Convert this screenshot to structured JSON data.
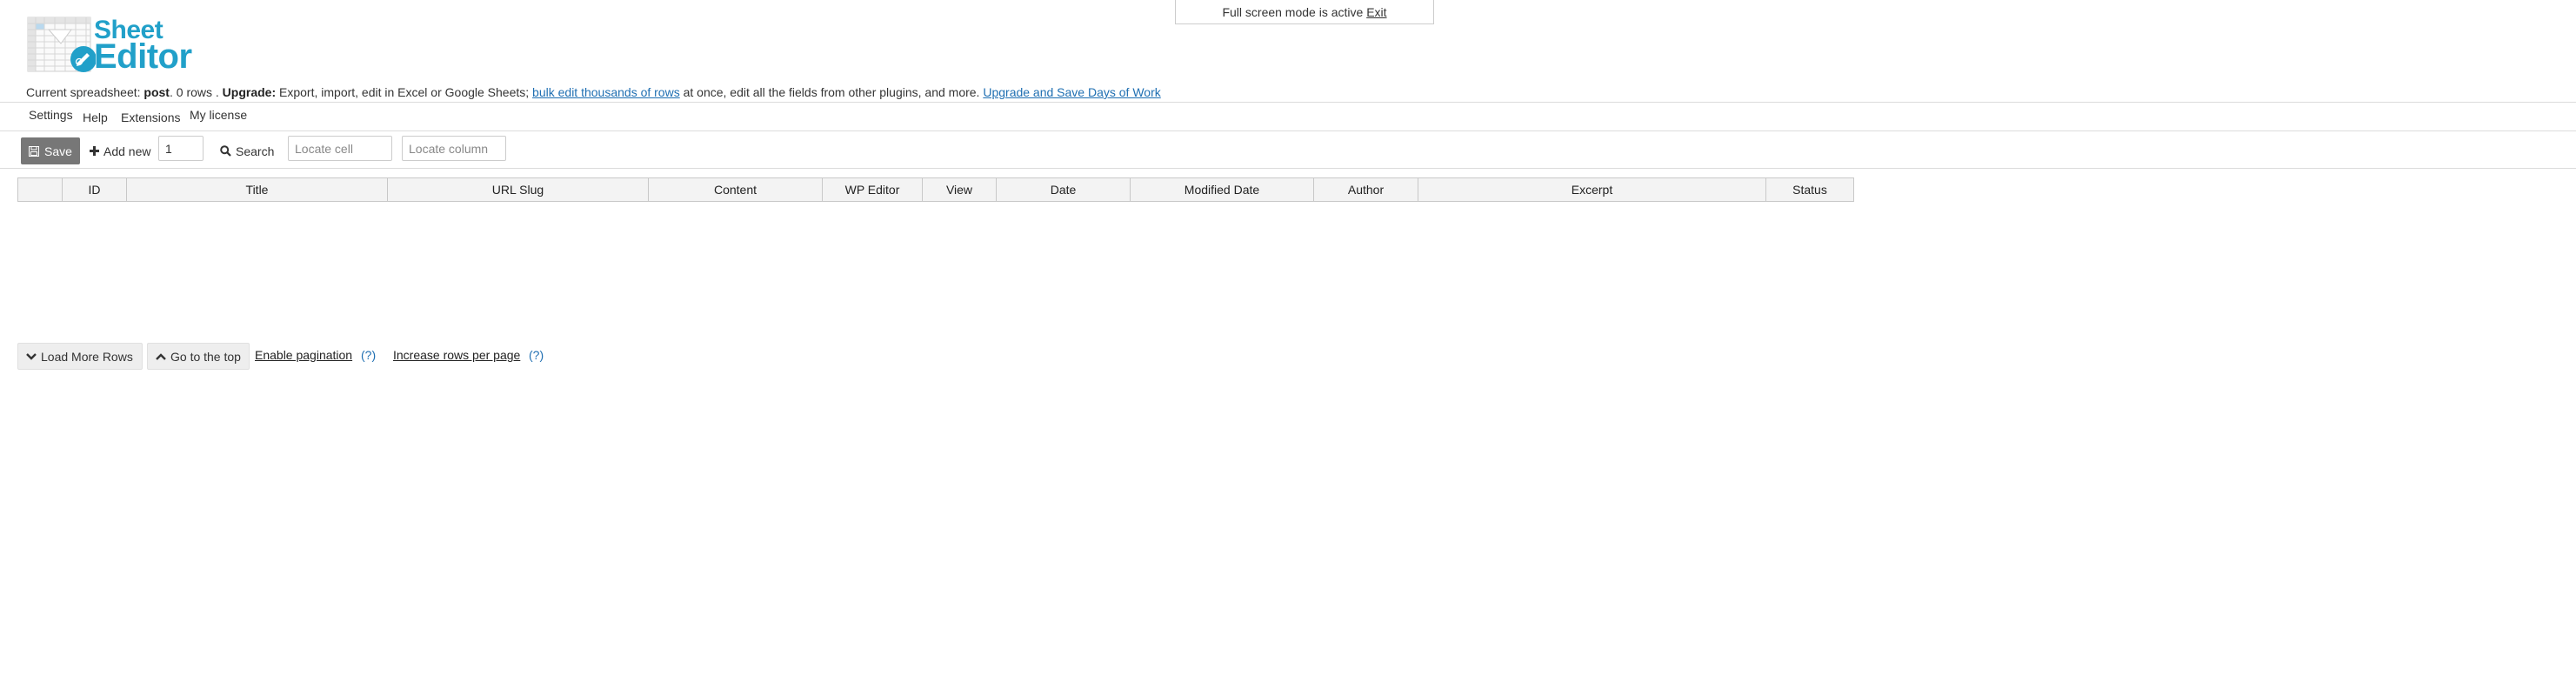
{
  "banner": {
    "text": "Full screen mode is active",
    "exit_label": "Exit"
  },
  "logo": {
    "line1": "Sheet",
    "line2": "Editor"
  },
  "info": {
    "prefix": "Current spreadsheet:",
    "sheet": "post",
    "rows": ". 0 rows .",
    "upgrade_label": "Upgrade:",
    "upgrade_text": "Export, import, edit in Excel or Google Sheets;",
    "bulk_link": "bulk edit thousands of rows",
    "middle_text": "at once, edit all the fields from other plugins, and more.",
    "upgrade_link": "Upgrade and Save Days of Work"
  },
  "menu": {
    "items": [
      "Settings",
      "Help",
      "Extensions",
      "My license"
    ]
  },
  "toolbar": {
    "save_label": "Save",
    "add_new_label": "Add new",
    "add_new_count": "1",
    "search_label": "Search",
    "locate_cell_placeholder": "Locate cell",
    "locate_column_placeholder": "Locate column"
  },
  "grid": {
    "columns": [
      "",
      "ID",
      "Title",
      "URL Slug",
      "Content",
      "WP Editor",
      "View",
      "Date",
      "Modified Date",
      "Author",
      "Excerpt",
      "Status"
    ]
  },
  "footer": {
    "load_more_label": "Load More Rows",
    "go_top_label": "Go to the top",
    "enable_pagination_label": "Enable pagination",
    "help1": "(?)",
    "increase_rows_label": "Increase rows per page",
    "help2": "(?)"
  },
  "colors": {
    "brand": "#21a0c9",
    "save_button": "#777777",
    "link": "#1f6fb2"
  }
}
